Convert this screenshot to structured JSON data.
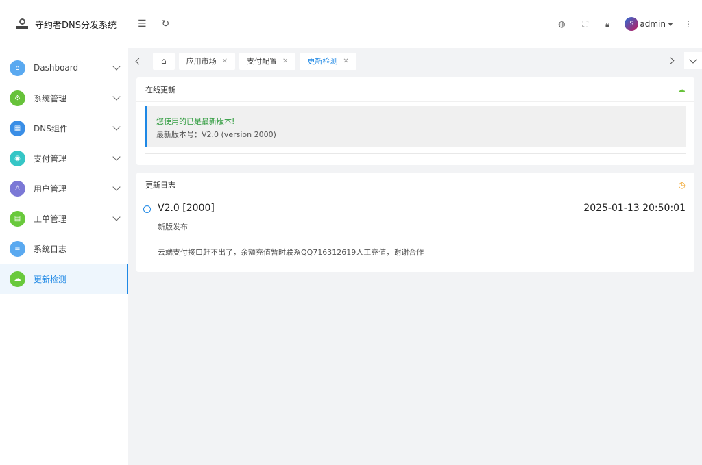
{
  "brand": {
    "title": "守约者DNS分发系统"
  },
  "sidebar": {
    "items": [
      {
        "label": "Dashboard",
        "icon": "home-icon",
        "color": "#5aa9f0",
        "has_children": true
      },
      {
        "label": "系统管理",
        "icon": "gear-icon",
        "color": "#67c23a",
        "has_children": true
      },
      {
        "label": "DNS组件",
        "icon": "grid-icon",
        "color": "#3a8ee6",
        "has_children": true
      },
      {
        "label": "支付管理",
        "icon": "target-icon",
        "color": "#36c6c6",
        "has_children": true
      },
      {
        "label": "用户管理",
        "icon": "user-icon",
        "color": "#7b78d6",
        "has_children": true
      },
      {
        "label": "工单管理",
        "icon": "ticket-icon",
        "color": "#69c93c",
        "has_children": true
      },
      {
        "label": "系统日志",
        "icon": "log-icon",
        "color": "#5aa9f0",
        "has_children": false
      },
      {
        "label": "更新检测",
        "icon": "cloud-upload-icon",
        "color": "#69c93c",
        "has_children": false,
        "active": true
      }
    ]
  },
  "topbar": {
    "username": "admin",
    "avatar_text": "S"
  },
  "tabs": [
    {
      "label": "应用市场",
      "closable": true
    },
    {
      "label": "支付配置",
      "closable": true
    },
    {
      "label": "更新检测",
      "closable": true,
      "active": true
    }
  ],
  "online_update": {
    "title": "在线更新",
    "status_text": "您使用的已是最新版本!",
    "version_text": "最新版本号：V2.0 (version 2000)"
  },
  "changelog": {
    "title": "更新日志",
    "entries": [
      {
        "version": "V2.0 [2000]",
        "time": "2025-01-13 20:50:01",
        "subtitle": "新版发布",
        "content": "云端支付接口赶不出了，余额充值暂时联系QQ716312619人工充值，谢谢合作"
      }
    ]
  },
  "colors": {
    "accent": "#1e88e5",
    "success": "#2e9b3d",
    "warning": "#f0a020"
  }
}
